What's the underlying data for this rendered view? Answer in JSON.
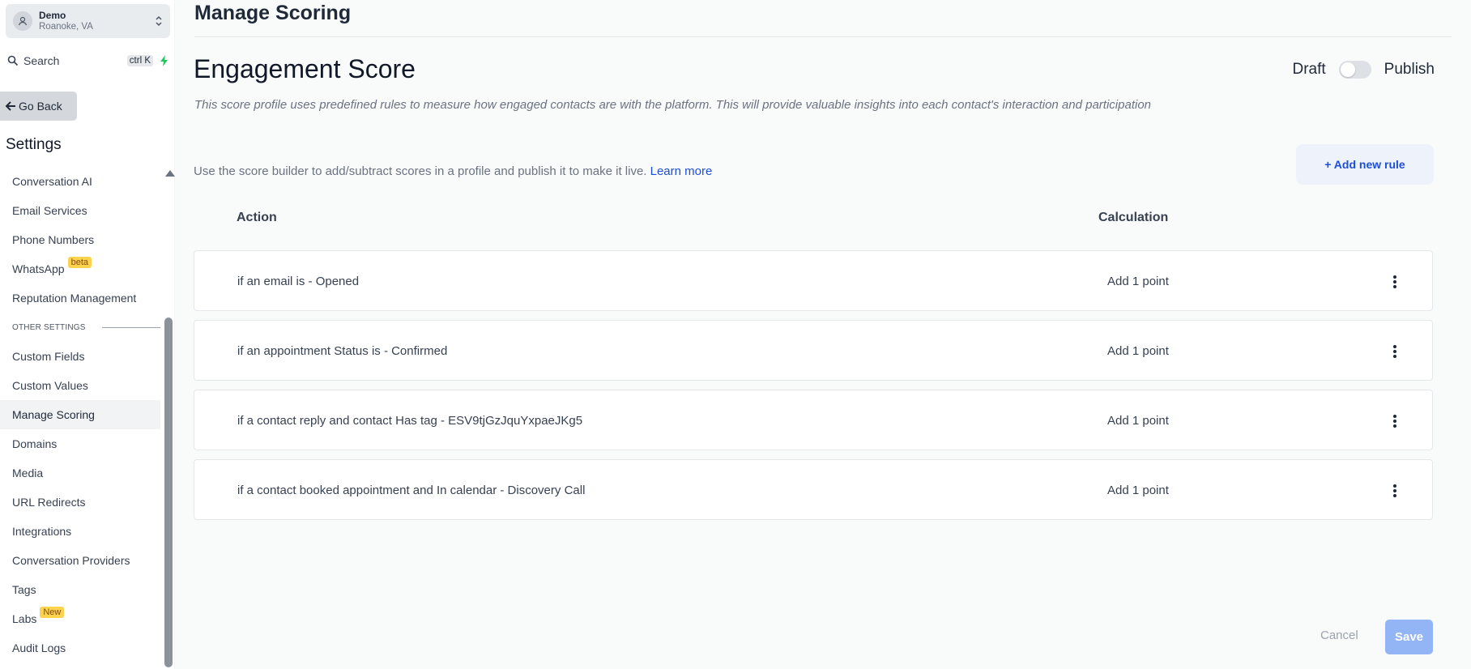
{
  "sidebar": {
    "account": {
      "name": "Demo",
      "location": "Roanoke, VA"
    },
    "search": {
      "label": "Search",
      "shortcut": "ctrl K"
    },
    "go_back": "Go Back",
    "settings_title": "Settings",
    "items_top": [
      {
        "label": "Conversation AI"
      },
      {
        "label": "Email Services"
      },
      {
        "label": "Phone Numbers"
      },
      {
        "label": "WhatsApp",
        "badge": "beta"
      },
      {
        "label": "Reputation Management"
      }
    ],
    "section_label": "OTHER SETTINGS",
    "items_bottom": [
      {
        "label": "Custom Fields"
      },
      {
        "label": "Custom Values"
      },
      {
        "label": "Manage Scoring",
        "active": true
      },
      {
        "label": "Domains"
      },
      {
        "label": "Media"
      },
      {
        "label": "URL Redirects"
      },
      {
        "label": "Integrations"
      },
      {
        "label": "Conversation Providers"
      },
      {
        "label": "Tags"
      },
      {
        "label": "Labs",
        "badge": "New"
      },
      {
        "label": "Audit Logs"
      }
    ]
  },
  "main": {
    "page_title": "Manage Scoring",
    "score_title": "Engagement Score",
    "toggle": {
      "draft_label": "Draft",
      "publish_label": "Publish",
      "published": false
    },
    "description": "This score profile uses predefined rules to measure how engaged contacts are with the platform. This will provide valuable insights into each contact's interaction and participation",
    "builder_note": "Use the score builder to add/subtract scores in a profile and publish it to make it live.",
    "learn_more": "Learn more",
    "add_rule_label": "+ Add new rule",
    "columns": {
      "action": "Action",
      "calculation": "Calculation"
    },
    "rules": [
      {
        "action": "if an email is - Opened",
        "calculation": "Add 1 point"
      },
      {
        "action": "if an appointment Status is - Confirmed",
        "calculation": "Add 1 point"
      },
      {
        "action": "if a contact reply and contact Has tag - ESV9tjGzJquYxpaeJKg5",
        "calculation": "Add 1 point"
      },
      {
        "action": "if a contact booked appointment and In calendar - Discovery Call",
        "calculation": "Add 1 point"
      }
    ],
    "cancel_label": "Cancel",
    "save_label": "Save"
  },
  "colors": {
    "accent": "#1d4ed8",
    "save_disabled": "#93b4f5",
    "badge": "#fcd34d",
    "active_item_bg": "#f1f3f5"
  },
  "icons": {
    "account": "user-circle-icon",
    "account_switch": "chevron-up-down-icon",
    "search": "search-icon",
    "quick_action": "lightning-icon",
    "back": "arrow-left-icon",
    "row_menu": "kebab-menu-icon"
  }
}
